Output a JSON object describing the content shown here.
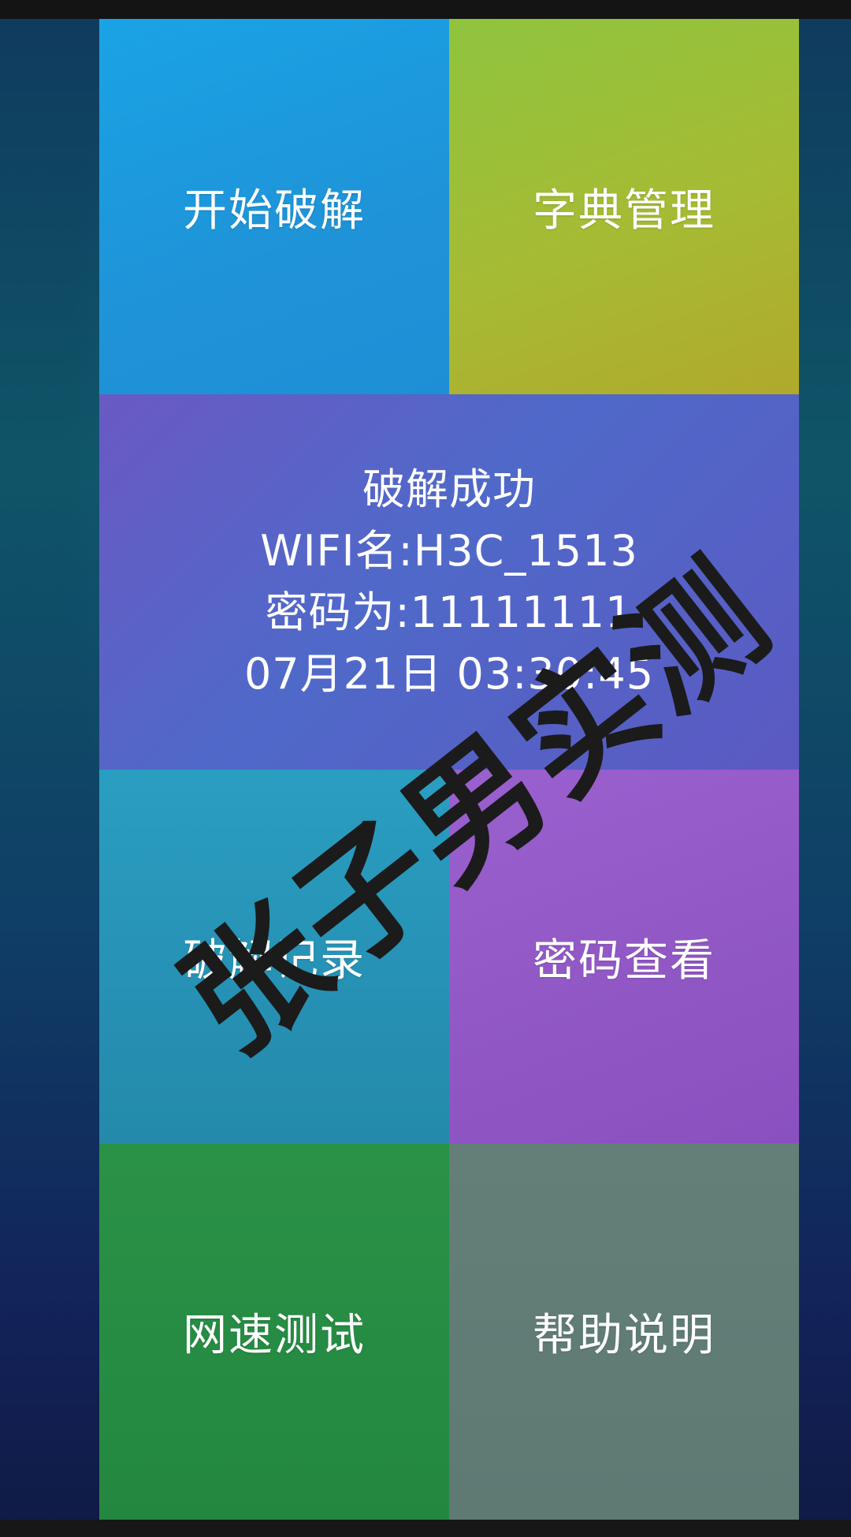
{
  "menu": {
    "start_crack": "开始破解",
    "dictionary_manage": "字典管理",
    "crack_history": "破解记录",
    "password_view": "密码查看",
    "speed_test": "网速测试",
    "help": "帮助说明"
  },
  "result": {
    "status": "破解成功",
    "wifi_name": "WIFI名:H3C_1513",
    "password": "密码为:11111111",
    "timestamp": "07月21日 03:30:45"
  },
  "watermark": "张子男实测"
}
